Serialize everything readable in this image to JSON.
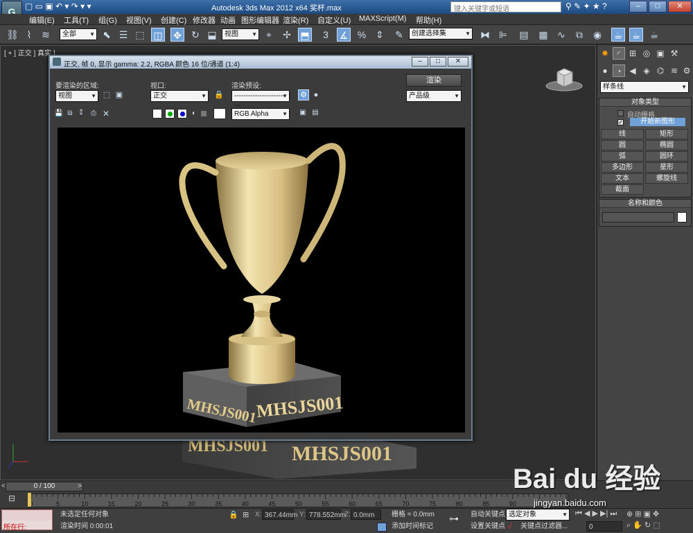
{
  "app": {
    "title": "Autodesk 3ds Max  2012 x64     奖杯.max",
    "search_placeholder": "键入关键字或短语",
    "logo": "3ds-max-logo-icon",
    "window_controls": [
      "–",
      "□",
      "✕"
    ]
  },
  "menu": [
    "编辑(E)",
    "工具(T)",
    "组(G)",
    "视图(V)",
    "创建(C)",
    "修改器",
    "动画",
    "图形编辑器",
    "渲染(R)",
    "自定义(U)",
    "MAXScript(M)",
    "帮助(H)"
  ],
  "toolbar": {
    "selection_filter": "全部",
    "ref_coord": "视图",
    "named_selection": "创建选择集"
  },
  "viewport": {
    "label": "[ + ] 正交 ] 真实 ]"
  },
  "render_frame": {
    "title": "正交, 帧 0, 显示 gamma: 2.2, RGBA 颜色 16 位/通道 (1:4)",
    "region_label": "要渲染的区域:",
    "region_value": "视图",
    "viewport_label": "视口:",
    "viewport_value": "正交",
    "preset_label": "渲染预设:",
    "preset_value": "-------------------------",
    "render_button": "渲染",
    "quality_value": "产品级",
    "channel_value": "RGB Alpha",
    "render_text": "MHSJS001",
    "render_text_side": "MHSJS001",
    "reflection_text": "MHSJS001"
  },
  "command_panel": {
    "category": "样条线",
    "object_type_header": "对象类型",
    "auto_grid": "自动栅格",
    "start_new_shape": "开始新图形",
    "object_buttons": [
      "线",
      "矩形",
      "圆",
      "椭圆",
      "弧",
      "圆环",
      "多边形",
      "星形",
      "文本",
      "螺旋线",
      "截面"
    ],
    "name_color_header": "名称和颜色"
  },
  "timeline": {
    "slider": "0 / 100",
    "ticks": [
      "0",
      "5",
      "10",
      "15",
      "20",
      "25",
      "30",
      "35",
      "40",
      "45",
      "50",
      "55",
      "60",
      "65",
      "70",
      "75",
      "80",
      "85",
      "90",
      "95",
      "100"
    ]
  },
  "status": {
    "listener": "所在行:",
    "selection": "未选定任何对象",
    "render_time": "渲染时间 0:00:01",
    "x_label": "X:",
    "x_value": "367.44mm",
    "y_label": "Y:",
    "y_value": "778.552mm",
    "z_label": "Z:",
    "z_value": "0.0mm",
    "grid": "栅格 = 0.0mm",
    "add_time_tag": "添加时间标记",
    "auto_key": "自动关键点",
    "set_key": "设置关键点",
    "selected_object": "选定对象",
    "key_filters": "关键点过滤器...",
    "frame": "0"
  },
  "watermark": {
    "brand": "Bai du 经验",
    "url": "jingyan.baidu.com"
  },
  "colors": {
    "accent": "#6fa0d8",
    "trophy": "#e6d29a",
    "title_bar": "#2a5a95"
  }
}
